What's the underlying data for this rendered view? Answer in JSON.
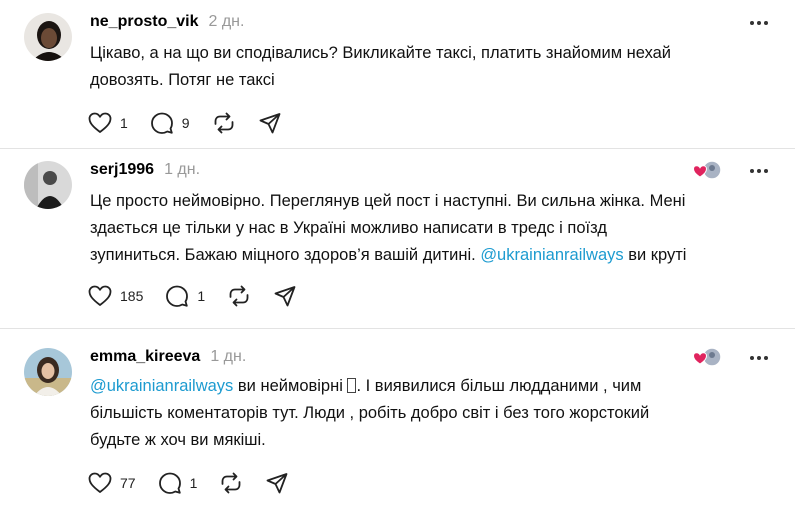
{
  "posts": [
    {
      "username": "ne_prosto_vik",
      "time": "2 дн.",
      "lines": [
        "Цікаво, а на що ви сподівались? Викликайте таксі, платить знайомим нехай",
        "довозять. Потяг не таксі"
      ],
      "likes": "1",
      "replies": "9",
      "avatar_icon": "woman-portrait-avatar"
    },
    {
      "username": "serj1996",
      "time": "1 дн.",
      "lines": [
        "Це просто неймовірно. Переглянув цей пост і наступні. Ви сильна жінка. Мені",
        "здається це тільки у нас в Україні можливо написати в тредс і поїзд",
        "зупиниться. Бажаю міцного здоров’я вашій дитині."
      ],
      "mention": "@ukrainianrailways",
      "after_mention": " ви круті",
      "likes": "185",
      "replies": "1",
      "avatar_icon": "man-portrait-avatar"
    },
    {
      "username": "emma_kireeva",
      "time": "1 дн.",
      "mention": "@ukrainianrailways",
      "first_line_rest": " ви неймовірні ",
      "first_line_end": ". І виявилися більш людданими , чим",
      "lines": [
        "більшість коментаторів тут. Люди , робіть добро світ і без того жорстокий",
        "будьте ж хоч ви мякіші."
      ],
      "likes": "77",
      "replies": "1",
      "avatar_icon": "woman-outdoor-avatar"
    }
  ],
  "icons": {
    "like": "heart-icon",
    "reply": "comment-icon",
    "repost": "repost-icon",
    "share": "send-icon",
    "more": "more-icon",
    "liked_by": "liked-by-author-icon"
  },
  "colors": {
    "mention": "#1d9bd0",
    "time": "#999999",
    "divider": "#e3e3e3",
    "heart_badge": "#e0245e"
  }
}
